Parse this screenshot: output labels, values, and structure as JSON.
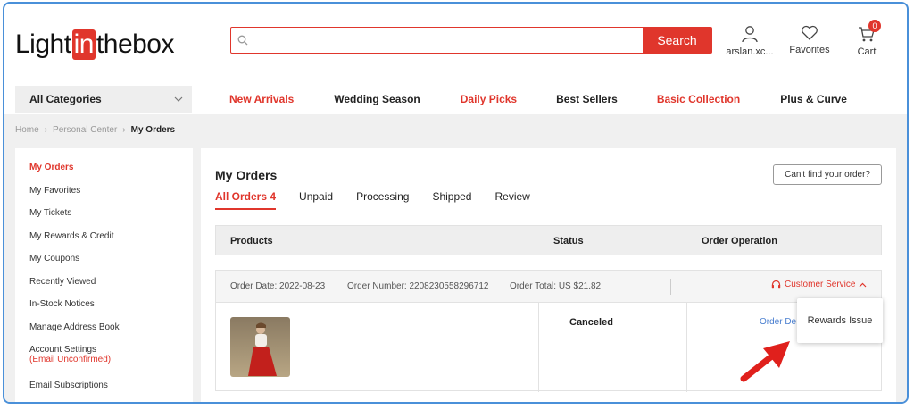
{
  "brand": {
    "logo_pre": "Light",
    "logo_in": "in",
    "logo_post": "thebox"
  },
  "search": {
    "placeholder": "",
    "button": "Search"
  },
  "header": {
    "account": "arslan.xc...",
    "favorites": "Favorites",
    "cart": "Cart",
    "cart_count": "0"
  },
  "nav": {
    "all_categories": "All Categories",
    "links": [
      {
        "label": "New Arrivals",
        "color": "#e0362c"
      },
      {
        "label": "Wedding Season",
        "color": "#222222"
      },
      {
        "label": "Daily Picks",
        "color": "#e0362c"
      },
      {
        "label": "Best Sellers",
        "color": "#222222"
      },
      {
        "label": "Basic Collection",
        "color": "#e0362c"
      },
      {
        "label": "Plus & Curve",
        "color": "#222222"
      }
    ]
  },
  "breadcrumb": {
    "home": "Home",
    "personal": "Personal Center",
    "current": "My Orders"
  },
  "sidebar": {
    "items": [
      "My Orders",
      "My Favorites",
      "My Tickets",
      "My Rewards & Credit",
      "My Coupons",
      "Recently Viewed",
      "In-Stock Notices",
      "Manage Address Book",
      "Account Settings",
      "Email Subscriptions"
    ],
    "account_settings_note": "(Email Unconfirmed)"
  },
  "main": {
    "title": "My Orders",
    "find_button": "Can't find your order?",
    "tabs": [
      "All Orders 4",
      "Unpaid",
      "Processing",
      "Shipped",
      "Review"
    ],
    "columns": {
      "products": "Products",
      "status": "Status",
      "operation": "Order Operation"
    },
    "order": {
      "date": "Order Date: 2022-08-23",
      "number": "Order Number: 2208230558296712",
      "total": "Order Total: US $21.82",
      "customer_service": "Customer Service",
      "status": "Canceled",
      "detail_link": "Order De"
    },
    "popup": "Rewards Issue"
  },
  "colors": {
    "accent": "#e0362c",
    "frame": "#4a90d9",
    "link": "#4a7fd0"
  }
}
